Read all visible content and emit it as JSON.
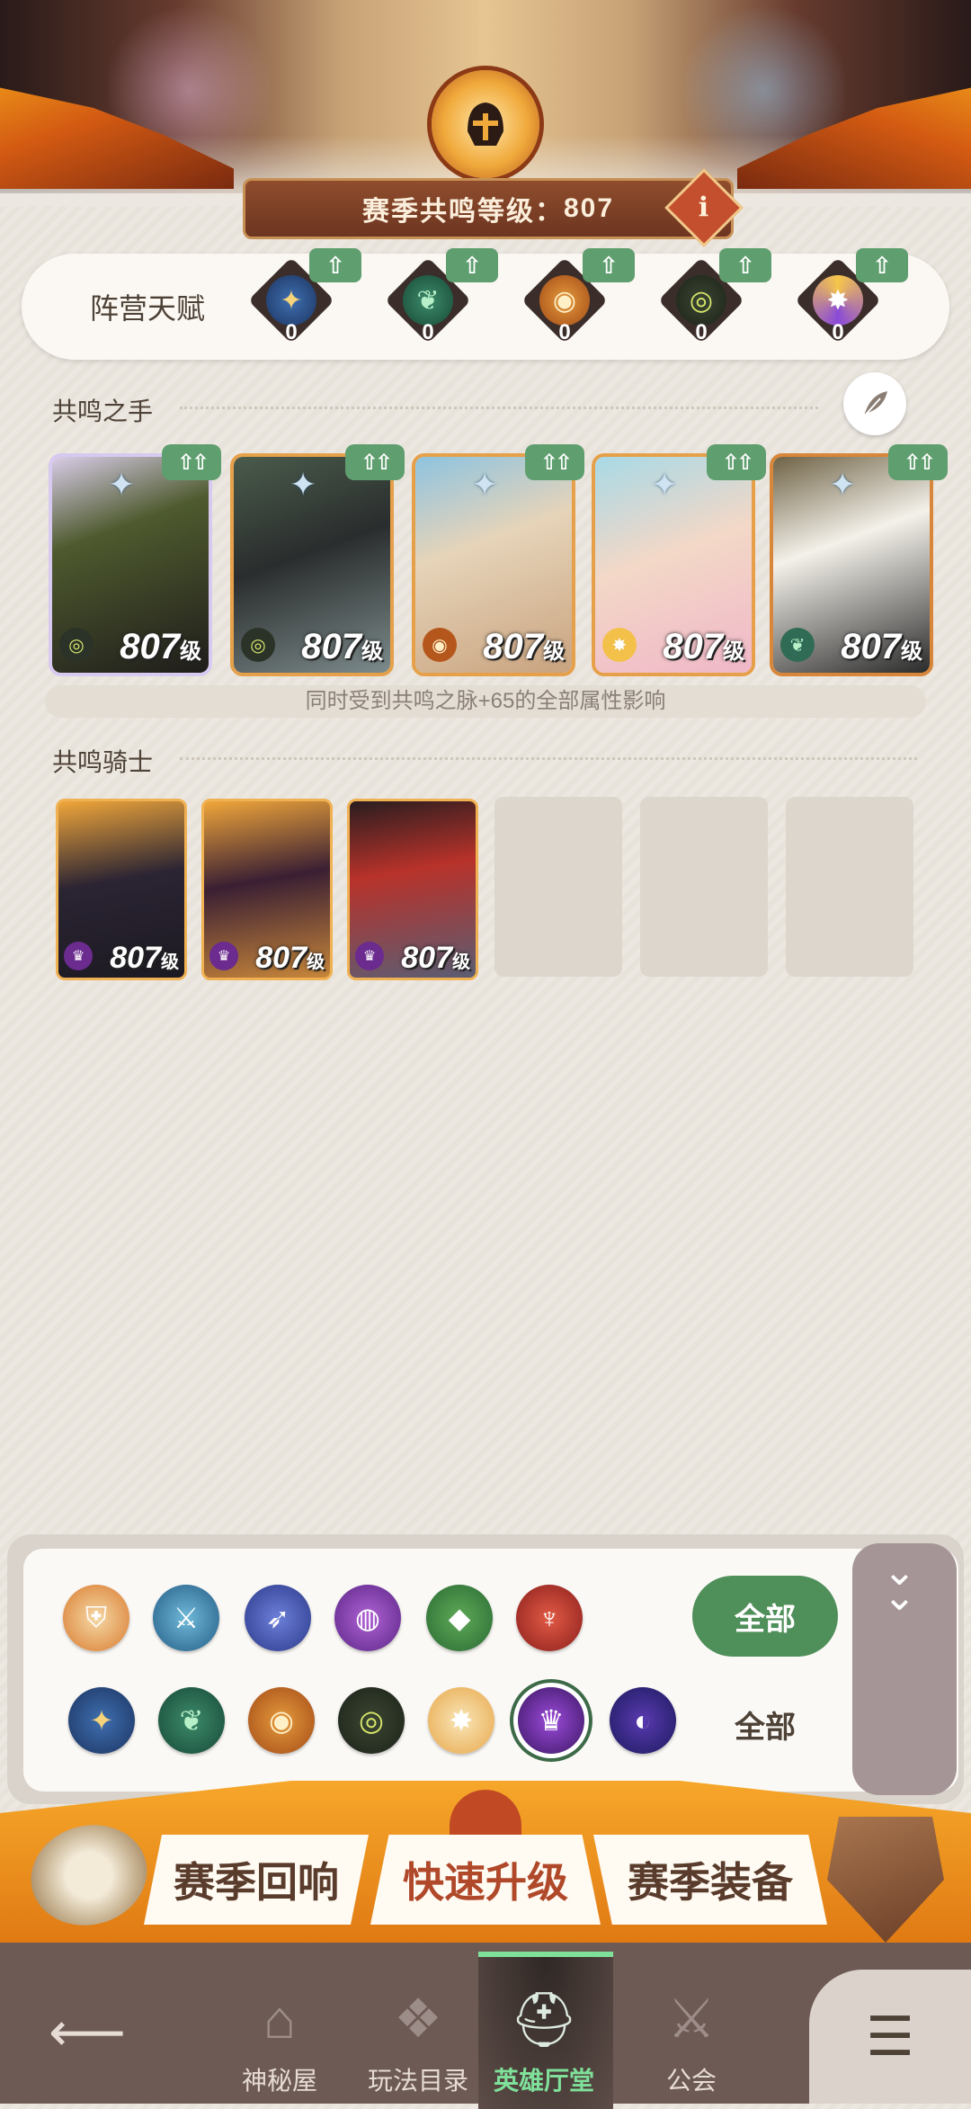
{
  "header": {
    "season_label": "赛季共鸣等级：",
    "season_level": "807",
    "info_icon": "i"
  },
  "faction_talent": {
    "title": "阵营天赋",
    "upgrade_icon": "arrow-up-icon",
    "slots": [
      {
        "faction": "lightbearer",
        "count": "0"
      },
      {
        "faction": "wilder",
        "count": "0"
      },
      {
        "faction": "graveborn",
        "count": "0"
      },
      {
        "faction": "mauler",
        "count": "0"
      },
      {
        "faction": "celestial",
        "count": "0"
      }
    ]
  },
  "resonance_hands": {
    "title": "共鸣之手",
    "heroes": [
      {
        "level": "807",
        "unit": "级",
        "faction": "mauler"
      },
      {
        "level": "807",
        "unit": "级",
        "faction": "mauler"
      },
      {
        "level": "807",
        "unit": "级",
        "faction": "graveborn"
      },
      {
        "level": "807",
        "unit": "级",
        "faction": "celestial"
      },
      {
        "level": "807",
        "unit": "级",
        "faction": "wilder"
      }
    ],
    "note": "同时受到共鸣之脉+65的全部属性影响"
  },
  "resonance_knights": {
    "title": "共鸣骑士",
    "heroes": [
      {
        "level": "807",
        "unit": "级"
      },
      {
        "level": "807",
        "unit": "级"
      },
      {
        "level": "807",
        "unit": "级"
      }
    ]
  },
  "filters": {
    "class_all": "全部",
    "faction_all": "全部"
  },
  "season_menu": {
    "left": "赛季回响",
    "mid": "快速升级",
    "right": "赛季装备"
  },
  "nav": {
    "items": [
      "神秘屋",
      "玩法目录",
      "英雄厅堂",
      "公会"
    ]
  },
  "colors": {
    "green": "#5f9e6e",
    "banner": "#6d3520",
    "nav": "#6d5a55"
  }
}
